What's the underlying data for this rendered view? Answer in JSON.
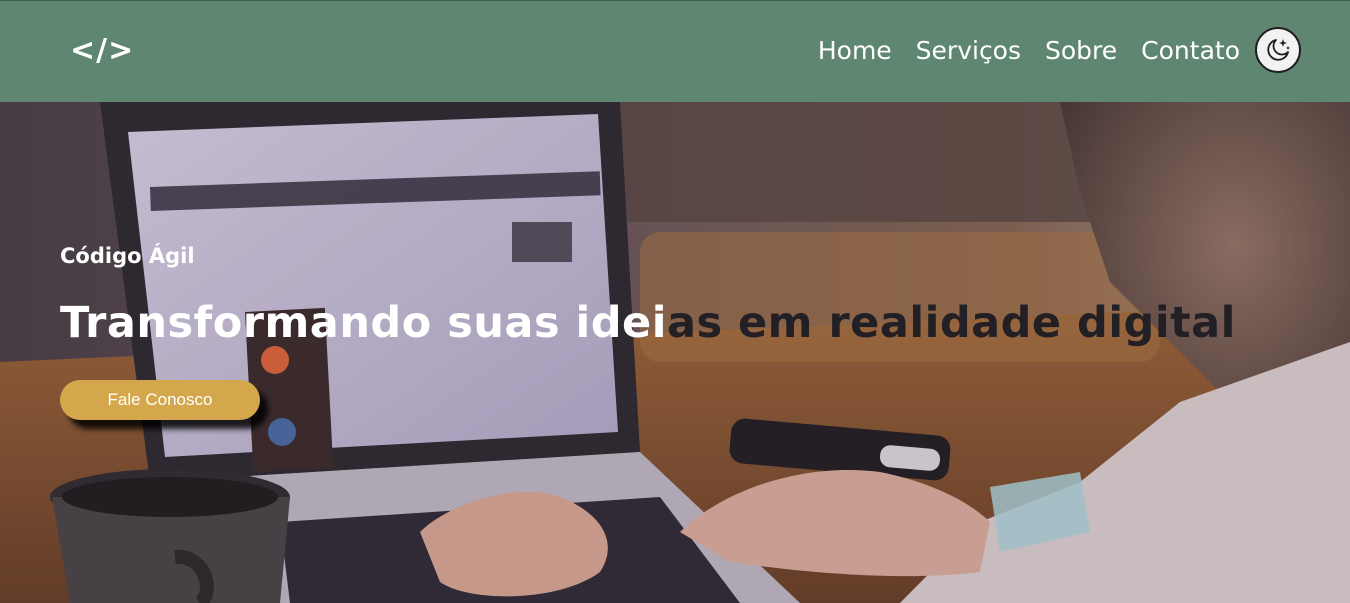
{
  "navbar": {
    "logo": "</>",
    "links": [
      {
        "label": "Home"
      },
      {
        "label": "Serviços"
      },
      {
        "label": "Sobre"
      },
      {
        "label": "Contato"
      }
    ],
    "theme_toggle_icon": "moon-stars-icon",
    "background_color": "#5e8670"
  },
  "hero": {
    "brand": "Código Ágil",
    "headline_light": "Transformando suas idei",
    "headline_dark": "as em realidade digital",
    "cta_label": "Fale Conosco",
    "cta_color": "#d4a74c",
    "background_image": "laptop-typing-photo"
  }
}
